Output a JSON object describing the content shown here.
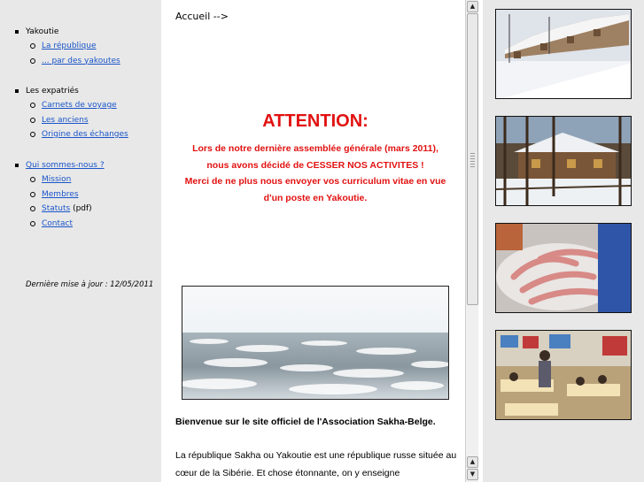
{
  "nav": {
    "groups": [
      {
        "label": "Yakoutie",
        "items": [
          {
            "text": "La république",
            "link": true
          },
          {
            "text": "... par des yakoutes",
            "link": true
          }
        ]
      },
      {
        "label": "Les expatriés",
        "items": [
          {
            "text": "Carnets de voyage",
            "link": true
          },
          {
            "text": "Les anciens",
            "link": true
          },
          {
            "text": "Origine des échanges",
            "link": true
          }
        ]
      },
      {
        "label": "Qui sommes-nous ?",
        "items": [
          {
            "text": "Mission",
            "link": true
          },
          {
            "text": "Membres",
            "link": true
          },
          {
            "text": "Statuts",
            "link": true,
            "suffix": " (pdf)"
          },
          {
            "text": "Contact",
            "link": true
          }
        ]
      }
    ],
    "last_update": "Dernière mise à jour : 12/05/2011"
  },
  "main": {
    "breadcrumb": "Accueil -->",
    "attention_title": "ATTENTION:",
    "alert_lines": [
      "Lors de notre dernière assemblée générale (mars 2011),",
      "nous avons décidé de CESSER NOS ACTIVITES !",
      "Merci de ne plus nous envoyer vos curriculum vitae en vue",
      "d'un poste en Yakoutie."
    ],
    "welcome": "Bienvenue sur le site officiel de l'Association Sakha-Belge.",
    "intro": "La république Sakha ou Yakoutie est une république russe située au cœur de la Sibérie. Et chose étonnante, on y enseigne"
  },
  "scrollbar": {
    "up_arrow": "▲",
    "down_arrow": "▼"
  },
  "colors": {
    "alert": "#e21111",
    "link": "#1a55c9",
    "sidebar_bg": "#e8e8e8"
  }
}
